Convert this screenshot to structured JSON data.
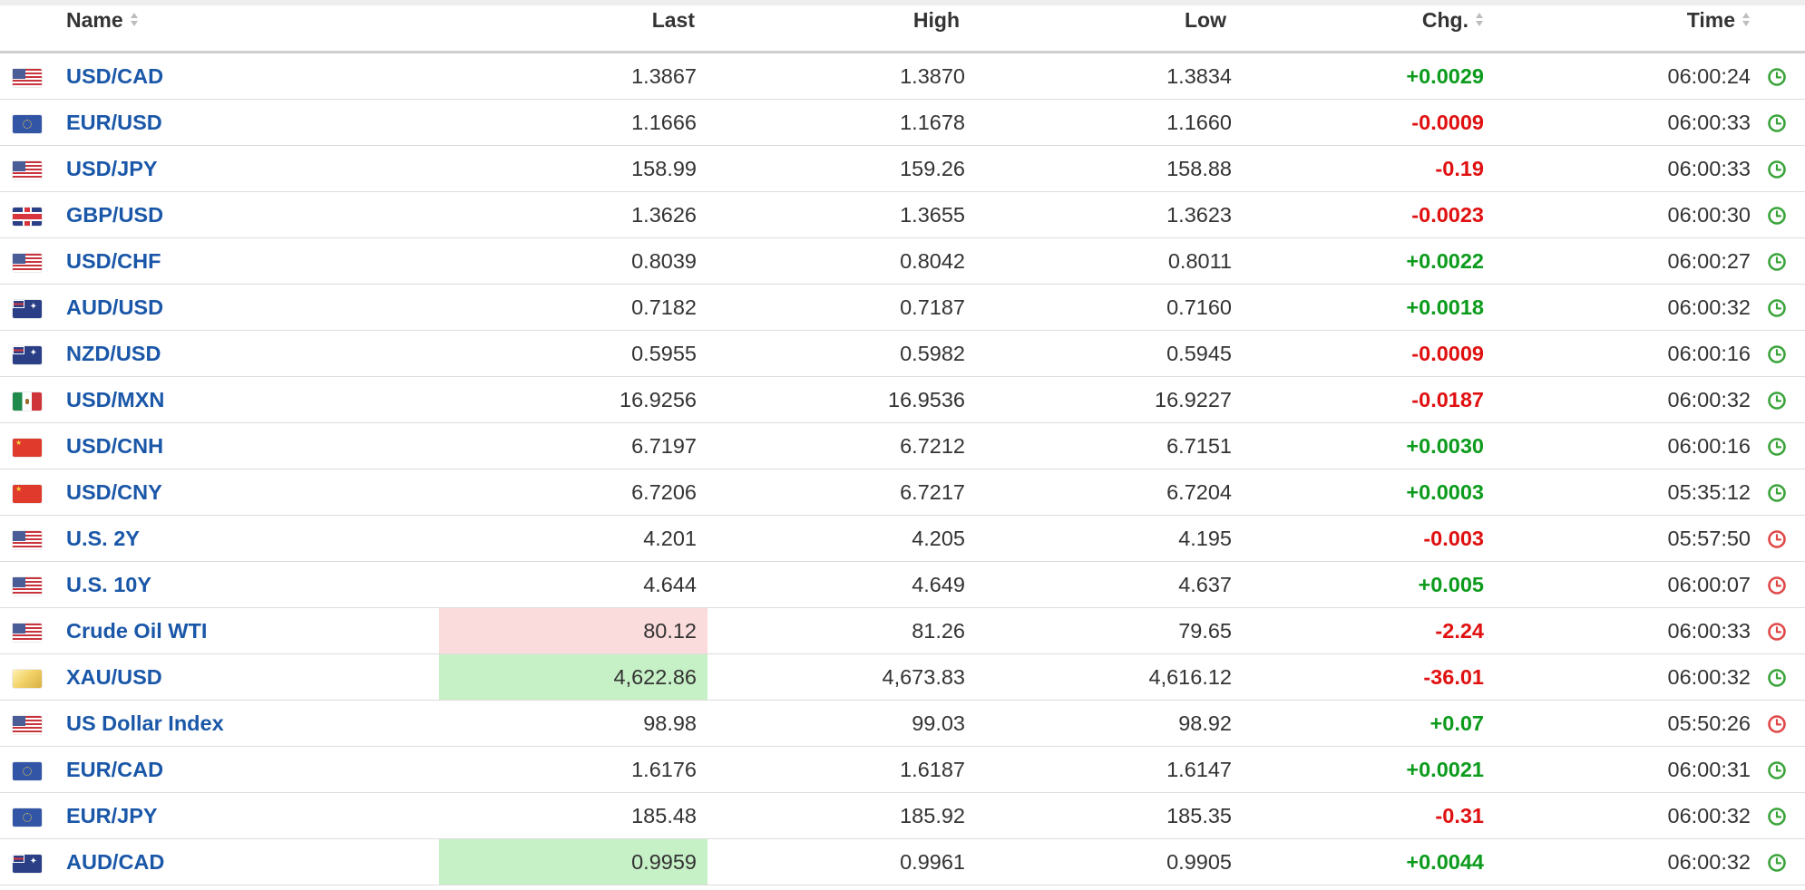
{
  "columns": {
    "name": "Name",
    "last": "Last",
    "high": "High",
    "low": "Low",
    "chg": "Chg.",
    "time": "Time"
  },
  "colors": {
    "link": "#1a57a8",
    "positive": "#0c9b1c",
    "negative": "#e01010",
    "clock_open": "#3aa43a",
    "clock_closed": "#e04848",
    "flash_up": "#c6f0c6",
    "flash_down": "#fbdcdc"
  },
  "rows": [
    {
      "name": "USD/CAD",
      "flag": "flag-us",
      "last": "1.3867",
      "high": "1.3870",
      "low": "1.3834",
      "chg": "+0.0029",
      "dir": "pos",
      "time": "06:00:24",
      "clock": "green-clock-icon",
      "flash": ""
    },
    {
      "name": "EUR/USD",
      "flag": "flag-eu",
      "last": "1.1666",
      "high": "1.1678",
      "low": "1.1660",
      "chg": "-0.0009",
      "dir": "neg",
      "time": "06:00:33",
      "clock": "green-clock-icon",
      "flash": ""
    },
    {
      "name": "USD/JPY",
      "flag": "flag-us",
      "last": "158.99",
      "high": "159.26",
      "low": "158.88",
      "chg": "-0.19",
      "dir": "neg",
      "time": "06:00:33",
      "clock": "green-clock-icon",
      "flash": ""
    },
    {
      "name": "GBP/USD",
      "flag": "flag-gb",
      "last": "1.3626",
      "high": "1.3655",
      "low": "1.3623",
      "chg": "-0.0023",
      "dir": "neg",
      "time": "06:00:30",
      "clock": "green-clock-icon",
      "flash": ""
    },
    {
      "name": "USD/CHF",
      "flag": "flag-us",
      "last": "0.8039",
      "high": "0.8042",
      "low": "0.8011",
      "chg": "+0.0022",
      "dir": "pos",
      "time": "06:00:27",
      "clock": "green-clock-icon",
      "flash": ""
    },
    {
      "name": "AUD/USD",
      "flag": "flag-au",
      "last": "0.7182",
      "high": "0.7187",
      "low": "0.7160",
      "chg": "+0.0018",
      "dir": "pos",
      "time": "06:00:32",
      "clock": "green-clock-icon",
      "flash": ""
    },
    {
      "name": "NZD/USD",
      "flag": "flag-au",
      "last": "0.5955",
      "high": "0.5982",
      "low": "0.5945",
      "chg": "-0.0009",
      "dir": "neg",
      "time": "06:00:16",
      "clock": "green-clock-icon",
      "flash": ""
    },
    {
      "name": "USD/MXN",
      "flag": "flag-mx",
      "last": "16.9256",
      "high": "16.9536",
      "low": "16.9227",
      "chg": "-0.0187",
      "dir": "neg",
      "time": "06:00:32",
      "clock": "green-clock-icon",
      "flash": ""
    },
    {
      "name": "USD/CNH",
      "flag": "flag-cn",
      "last": "6.7197",
      "high": "6.7212",
      "low": "6.7151",
      "chg": "+0.0030",
      "dir": "pos",
      "time": "06:00:16",
      "clock": "green-clock-icon",
      "flash": ""
    },
    {
      "name": "USD/CNY",
      "flag": "flag-cn",
      "last": "6.7206",
      "high": "6.7217",
      "low": "6.7204",
      "chg": "+0.0003",
      "dir": "pos",
      "time": "05:35:12",
      "clock": "green-clock-icon",
      "flash": ""
    },
    {
      "name": "U.S. 2Y",
      "flag": "flag-us",
      "last": "4.201",
      "high": "4.205",
      "low": "4.195",
      "chg": "-0.003",
      "dir": "neg",
      "time": "05:57:50",
      "clock": "red-clock-icon",
      "flash": ""
    },
    {
      "name": "U.S. 10Y",
      "flag": "flag-us",
      "last": "4.644",
      "high": "4.649",
      "low": "4.637",
      "chg": "+0.005",
      "dir": "pos",
      "time": "06:00:07",
      "clock": "red-clock-icon",
      "flash": ""
    },
    {
      "name": "Crude Oil WTI",
      "flag": "flag-us",
      "last": "80.12",
      "high": "81.26",
      "low": "79.65",
      "chg": "-2.24",
      "dir": "neg",
      "time": "06:00:33",
      "clock": "red-clock-icon",
      "flash": "down"
    },
    {
      "name": "XAU/USD",
      "flag": "flag-gold",
      "last": "4,622.86",
      "high": "4,673.83",
      "low": "4,616.12",
      "chg": "-36.01",
      "dir": "neg",
      "time": "06:00:32",
      "clock": "green-clock-icon",
      "flash": "up"
    },
    {
      "name": "US Dollar Index",
      "flag": "flag-us",
      "last": "98.98",
      "high": "99.03",
      "low": "98.92",
      "chg": "+0.07",
      "dir": "pos",
      "time": "05:50:26",
      "clock": "red-clock-icon",
      "flash": ""
    },
    {
      "name": "EUR/CAD",
      "flag": "flag-eu",
      "last": "1.6176",
      "high": "1.6187",
      "low": "1.6147",
      "chg": "+0.0021",
      "dir": "pos",
      "time": "06:00:31",
      "clock": "green-clock-icon",
      "flash": ""
    },
    {
      "name": "EUR/JPY",
      "flag": "flag-eu",
      "last": "185.48",
      "high": "185.92",
      "low": "185.35",
      "chg": "-0.31",
      "dir": "neg",
      "time": "06:00:32",
      "clock": "green-clock-icon",
      "flash": ""
    },
    {
      "name": "AUD/CAD",
      "flag": "flag-au",
      "last": "0.9959",
      "high": "0.9961",
      "low": "0.9905",
      "chg": "+0.0044",
      "dir": "pos",
      "time": "06:00:32",
      "clock": "green-clock-icon",
      "flash": "up"
    }
  ]
}
